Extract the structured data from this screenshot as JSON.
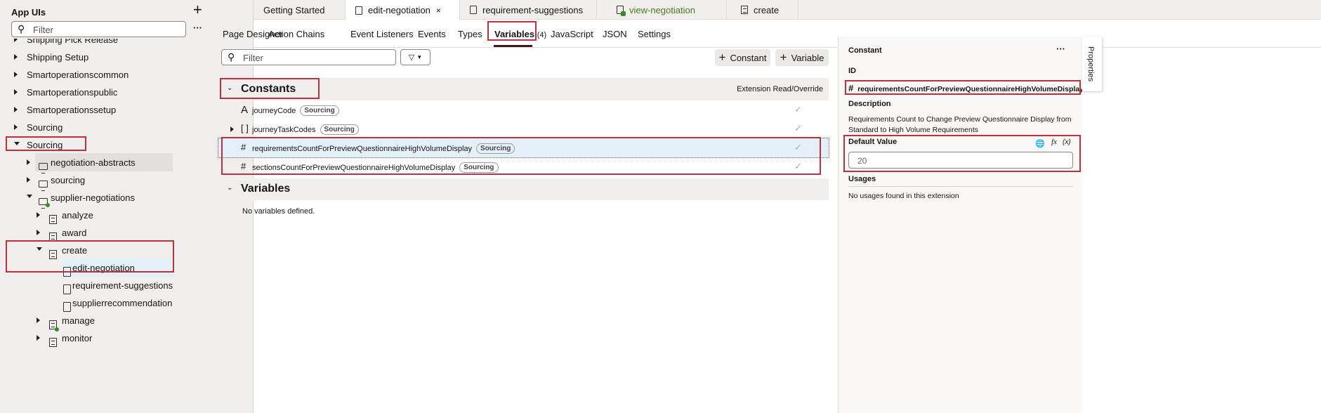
{
  "sidebar": {
    "title": "App UIs",
    "filter_placeholder": "Filter",
    "items": [
      {
        "label": "Shipping Pick Release",
        "level": 0,
        "expand": "collapsed"
      },
      {
        "label": "Shipping Setup",
        "level": 0,
        "expand": "collapsed"
      },
      {
        "label": "Smartoperationscommon",
        "level": 0,
        "expand": "collapsed"
      },
      {
        "label": "Smartoperationspublic",
        "level": 0,
        "expand": "collapsed"
      },
      {
        "label": "Smartoperationssetup",
        "level": 0,
        "expand": "collapsed"
      },
      {
        "label": "Sourcing",
        "level": 0,
        "expand": "collapsed"
      },
      {
        "label": "Sourcing",
        "level": 0,
        "expand": "expanded"
      },
      {
        "label": "negotiation-abstracts",
        "level": 1,
        "expand": "collapsed",
        "icon": "monitor-icon"
      },
      {
        "label": "sourcing",
        "level": 1,
        "expand": "collapsed",
        "icon": "monitor-icon"
      },
      {
        "label": "supplier-negotiations",
        "level": 1,
        "expand": "expanded",
        "icon": "monitor-icon",
        "dot": true
      },
      {
        "label": "analyze",
        "level": 2,
        "expand": "collapsed",
        "icon": "flow-icon"
      },
      {
        "label": "award",
        "level": 2,
        "expand": "collapsed",
        "icon": "flow-icon"
      },
      {
        "label": "create",
        "level": 2,
        "expand": "expanded",
        "icon": "flow-icon"
      },
      {
        "label": "edit-negotiation",
        "level": 3,
        "icon": "page-icon",
        "selected": true
      },
      {
        "label": "requirement-suggestions",
        "level": 3,
        "icon": "page-icon"
      },
      {
        "label": "supplierrecommendation",
        "level": 3,
        "icon": "page-icon"
      },
      {
        "label": "manage",
        "level": 2,
        "expand": "collapsed",
        "icon": "flow-icon",
        "dot": true
      },
      {
        "label": "monitor",
        "level": 2,
        "expand": "collapsed",
        "icon": "flow-icon"
      }
    ]
  },
  "tabs": [
    {
      "label": "Getting Started"
    },
    {
      "label": "edit-negotiation",
      "active": true,
      "closable": true
    },
    {
      "label": "requirement-suggestions"
    },
    {
      "label": "view-negotiation",
      "color": "#4a7a1f"
    },
    {
      "label": "create"
    }
  ],
  "subtabs": [
    "Page Designer",
    "Action Chains",
    "Event Listeners",
    "Events",
    "Types",
    "Variables",
    "JavaScript",
    "JSON",
    "Settings"
  ],
  "variables_count": "(4)",
  "main": {
    "filter_placeholder": "Filter",
    "add_constant": "Constant",
    "add_variable": "Variable",
    "constants_title": "Constants",
    "column_header": "Extension Read/Override",
    "constants": [
      {
        "type_icon": "string-icon",
        "glyph": "A",
        "name": "journeyCode",
        "badge": "Sourcing"
      },
      {
        "type_icon": "array-icon",
        "glyph": "[ ]",
        "name": "journeyTaskCodes",
        "badge": "Sourcing",
        "expandable": true
      },
      {
        "type_icon": "number-icon",
        "glyph": "#",
        "name": "requirementsCountForPreviewQuestionnaireHighVolumeDisplay",
        "badge": "Sourcing",
        "selected": true
      },
      {
        "type_icon": "number-icon",
        "glyph": "#",
        "name": "sectionsCountForPreviewQuestionnaireHighVolumeDisplay",
        "badge": "Sourcing"
      }
    ],
    "variables_title": "Variables",
    "no_variables": "No variables defined."
  },
  "properties": {
    "title": "Constant",
    "id_label": "ID",
    "id_value": "requirementsCountForPreviewQuestionnaireHighVolumeDisplay",
    "description_label": "Description",
    "description": "Requirements Count to Change Preview Questionnaire Display from Standard to High Volume Requirements",
    "default_label": "Default Value",
    "default_value": "20",
    "fx": "fx",
    "var": "(x)",
    "usages_label": "Usages",
    "usages_text": "No usages found in this extension",
    "rail_label": "Properties"
  },
  "colors": {
    "highlight_box": "#c0303a",
    "selected_row": "#e4f0f8",
    "panel_bg": "#f1efed"
  }
}
